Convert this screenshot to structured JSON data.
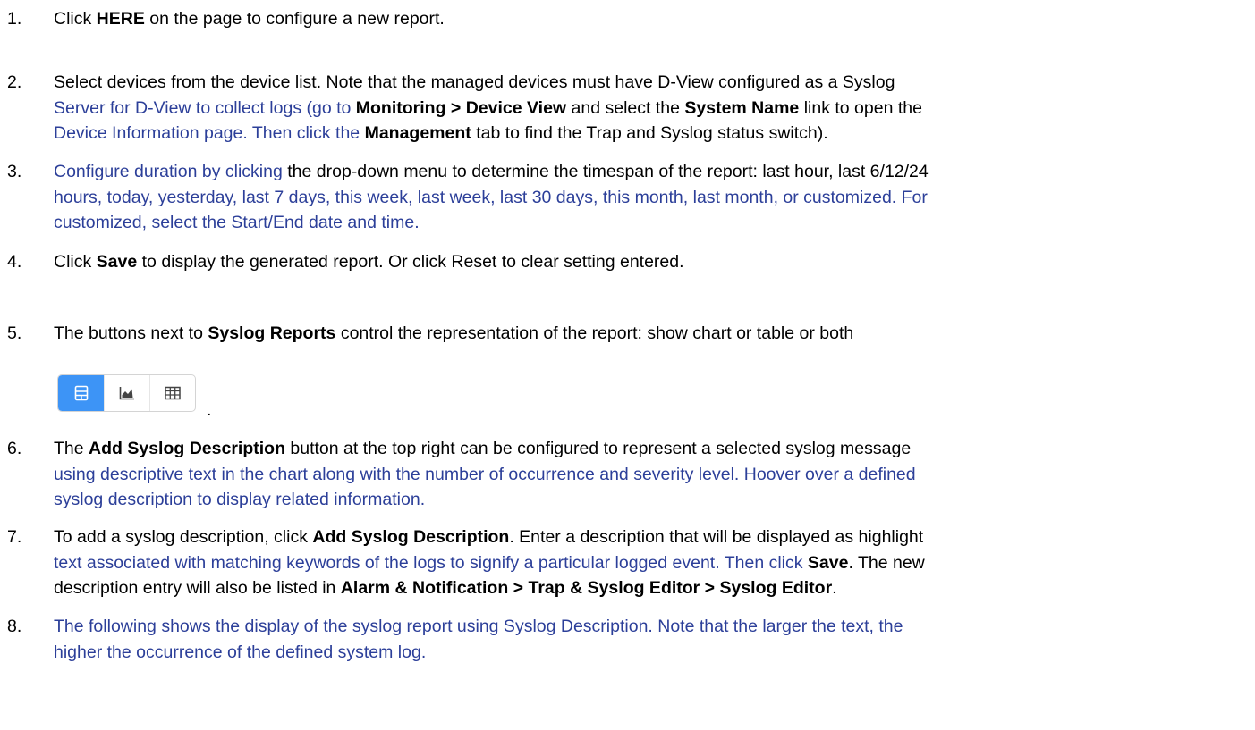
{
  "steps": [
    {
      "number": "1.",
      "lines": [
        [
          {
            "t": "Click "
          },
          {
            "t": "HERE",
            "b": true
          },
          {
            "t": " on the page to configure a new report."
          }
        ]
      ]
    },
    {
      "number": "2.",
      "lines": [
        [
          {
            "t": "Select devices from the device list. Note that the managed devices must have D-View configured as a Syslog"
          }
        ],
        [
          {
            "t": "Server for D-View to collect logs (go to ",
            "blue": true
          },
          {
            "t": "Monitoring > Device View",
            "b": true
          },
          {
            "t": " and select the "
          },
          {
            "t": "System Name",
            "b": true
          },
          {
            "t": " link to open the"
          }
        ],
        [
          {
            "t": "Device Information page. Then click the ",
            "blue": true
          },
          {
            "t": "Management",
            "b": true
          },
          {
            "t": " tab to find the Trap and Syslog status switch)."
          }
        ]
      ]
    },
    {
      "number": "3.",
      "lines": [
        [
          {
            "t": "Configure duration by clicking ",
            "blue": true
          },
          {
            "t": "the drop-down menu to determine the timespan of the report: last hour, last 6/12/24"
          }
        ],
        [
          {
            "t": "hours, today, yesterday, last 7 days, this week, last week, last 30 days, this month, last month, or customized. For",
            "blue": true
          }
        ],
        [
          {
            "t": "customized, select the Start/End date and time.",
            "blue": true
          }
        ]
      ]
    },
    {
      "number": "4.",
      "lines": [
        [
          {
            "t": "Click "
          },
          {
            "t": "Save",
            "b": true
          },
          {
            "t": " to display the generated report. Or click Reset to clear setting entered."
          }
        ]
      ]
    },
    {
      "number": "5.",
      "lines": [
        [
          {
            "t": "The buttons next to "
          },
          {
            "t": "Syslog Reports",
            "b": true
          },
          {
            "t": " control the representation of the report: show chart or table or both"
          }
        ]
      ]
    },
    {
      "number": "6.",
      "lines": [
        [
          {
            "t": "The "
          },
          {
            "t": "Add Syslog Description",
            "b": true
          },
          {
            "t": " button at the top right can be configured to represent a selected syslog message"
          }
        ],
        [
          {
            "t": "using descriptive text in the chart along with the number of occurrence and severity level. Hoover over a defined",
            "blue": true
          }
        ],
        [
          {
            "t": "syslog description to display related information.",
            "blue": true
          }
        ]
      ]
    },
    {
      "number": "7.",
      "lines": [
        [
          {
            "t": "To add a syslog description, click "
          },
          {
            "t": "Add Syslog Description",
            "b": true
          },
          {
            "t": ".  Enter a description that will be displayed as highlight"
          }
        ],
        [
          {
            "t": "text associated with matching keywords of the logs to signify a particular logged event. Then click ",
            "blue": true
          },
          {
            "t": "Save",
            "b": true
          },
          {
            "t": ". The new"
          }
        ],
        [
          {
            "t": "description entry will also be listed in "
          },
          {
            "t": "Alarm & Notification > Trap & Syslog Editor > Syslog Editor",
            "b": true
          },
          {
            "t": "."
          }
        ]
      ]
    },
    {
      "number": "8.",
      "lines": [
        [
          {
            "t": "The following shows the display of the syslog report using Syslog Description. Note that the larger the text, the",
            "blue": true
          }
        ],
        [
          {
            "t": "higher the occurrence of the defined system log.",
            "blue": true
          }
        ]
      ]
    }
  ],
  "view_toggle": {
    "buttons": [
      {
        "icon": "chart-and-table-icon",
        "active": true
      },
      {
        "icon": "area-chart-icon",
        "active": false
      },
      {
        "icon": "table-grid-icon",
        "active": false
      }
    ],
    "colors": {
      "active_bg": "#3d94f6",
      "active_icon": "#ffffff",
      "inactive_icon": "#444444"
    }
  },
  "trailing_period": "."
}
